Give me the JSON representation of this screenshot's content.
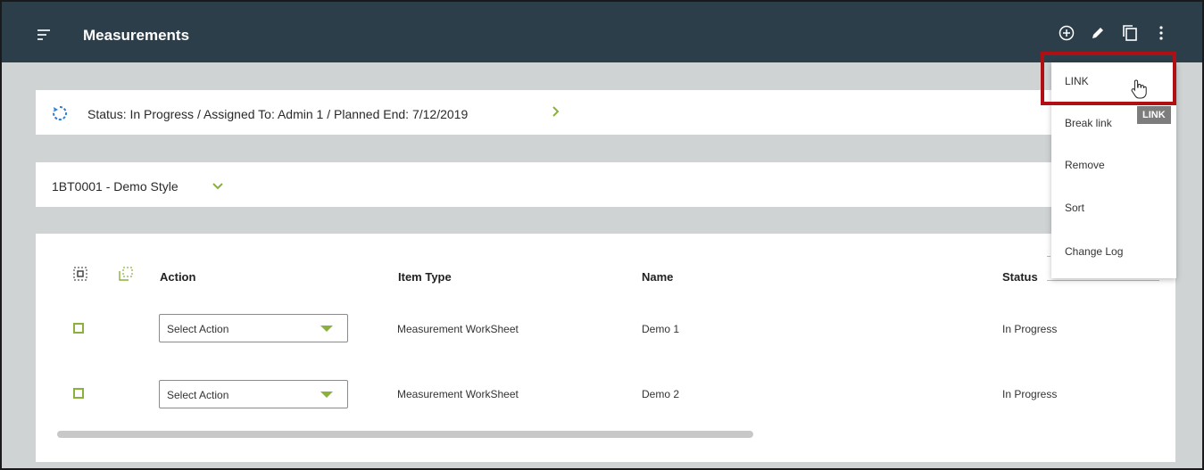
{
  "header": {
    "title": "Measurements",
    "icons": [
      "menu-icon",
      "add-circle-icon",
      "edit-pencil-icon",
      "copy-icon",
      "more-vertical-icon"
    ]
  },
  "status_bar": {
    "text": "Status: In Progress / Assigned To: Admin 1 / Planned End: 7/12/2019",
    "icon": "sync-icon"
  },
  "style_selector": {
    "text": "1BT0001 - Demo Style"
  },
  "table": {
    "columns": [
      "Action",
      "Item Type",
      "Name",
      "Status"
    ],
    "rows": [
      {
        "action": "Select Action",
        "item_type": "Measurement WorkSheet",
        "name": "Demo 1",
        "status": "In Progress"
      },
      {
        "action": "Select Action",
        "item_type": "Measurement WorkSheet",
        "name": "Demo 2",
        "status": "In Progress"
      }
    ]
  },
  "more_menu": {
    "items": [
      "LINK",
      "Break link",
      "Remove",
      "Sort",
      "Change Log"
    ],
    "tooltip": "LINK"
  },
  "colors": {
    "topbar": "#2c3e4a",
    "accent_green": "#8ab13c",
    "highlight_red": "#b00f14",
    "background": "#cfd3d3"
  }
}
